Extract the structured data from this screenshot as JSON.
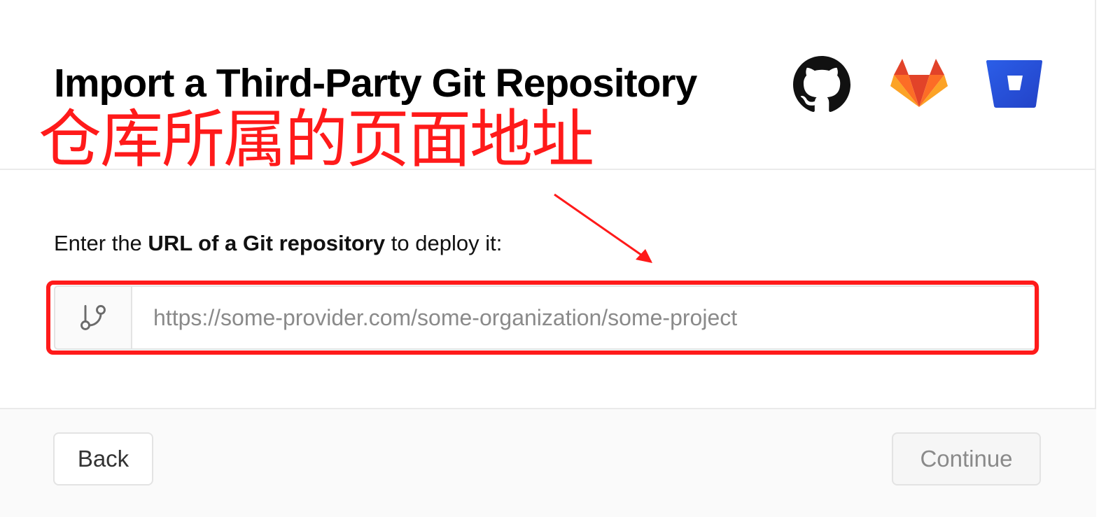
{
  "header": {
    "title": "Import a Third-Party Git Repository",
    "providers": [
      {
        "name": "GitHub",
        "icon": "github-icon"
      },
      {
        "name": "GitLab",
        "icon": "gitlab-icon"
      },
      {
        "name": "Bitbucket",
        "icon": "bitbucket-icon"
      }
    ]
  },
  "annotation": {
    "text": "仓库所属的页面地址",
    "color": "#ff1a1a"
  },
  "form": {
    "prompt_prefix": "Enter the ",
    "prompt_bold": "URL of a Git repository",
    "prompt_suffix": " to deploy it:",
    "url_icon": "git-branch-icon",
    "url_value": "",
    "url_placeholder": "https://some-provider.com/some-organization/some-project"
  },
  "footer": {
    "back_label": "Back",
    "continue_label": "Continue"
  },
  "colors": {
    "border": "#eaeaea",
    "footer_bg": "#fafafa",
    "gitlab_orange": "#e24329",
    "bitbucket_blue": "#2b4fd8",
    "annotation_red": "#ff1a1a"
  }
}
